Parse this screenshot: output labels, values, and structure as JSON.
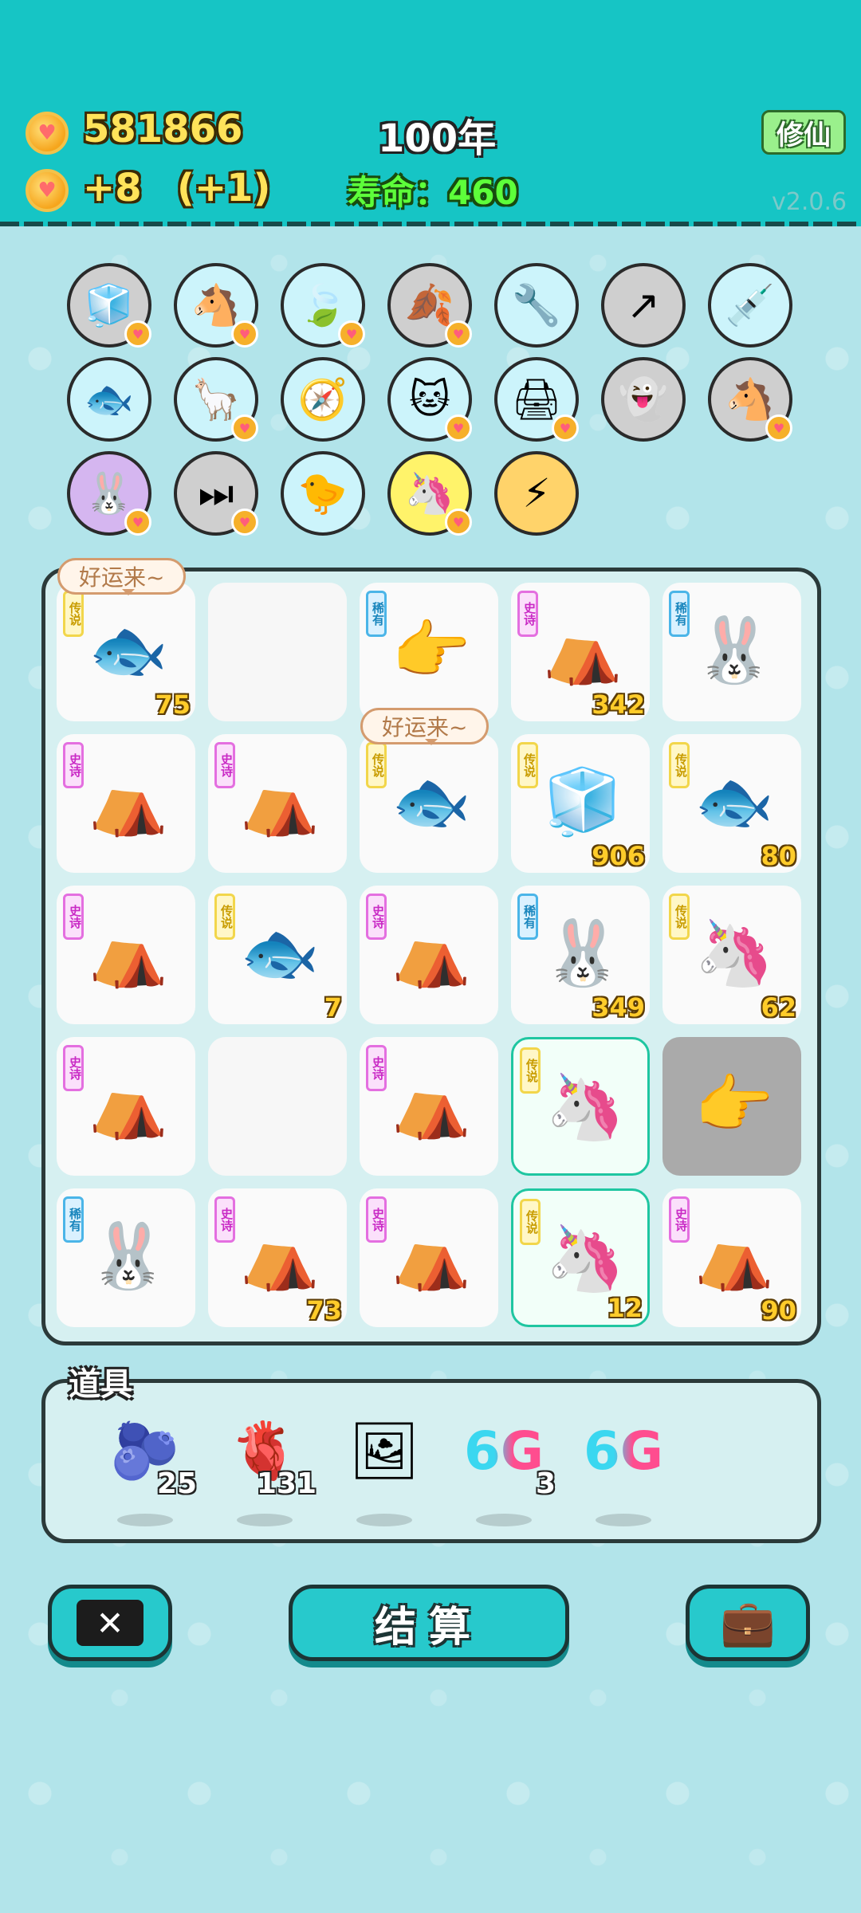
{
  "header": {
    "coins": "581866",
    "income": "+8",
    "bonus": "(+1)",
    "year": "100年",
    "lifespan": "寿命：460",
    "xiuxian_button": "修仙",
    "version": "v2.0.6"
  },
  "items": [
    {
      "icon": "🧊"
    },
    {
      "icon": "🐴"
    },
    {
      "icon": "🍃"
    },
    {
      "icon": "🍂"
    },
    {
      "icon": "🔧"
    },
    {
      "icon": "↗"
    },
    {
      "icon": "💉"
    },
    {
      "icon": "🐟"
    },
    {
      "icon": "🦙"
    },
    {
      "icon": "🧭"
    },
    {
      "icon": "🐱"
    },
    {
      "icon": "🖨"
    },
    {
      "icon": "👻"
    },
    {
      "icon": "🐴"
    },
    {
      "icon": "🐰"
    },
    {
      "icon": "⏭"
    },
    {
      "icon": "🐤"
    },
    {
      "icon": "🦄"
    },
    {
      "icon": "⚡"
    }
  ],
  "bubbles": [
    "好运来~",
    "好运来~"
  ],
  "tags": {
    "legend": "传说",
    "epic": "史诗",
    "rare": "稀有"
  },
  "board": [
    [
      {
        "tag": "legend",
        "icon": "🐟",
        "count": "75"
      },
      {
        "tag": "",
        "icon": "",
        "count": ""
      },
      {
        "tag": "rare",
        "icon": "👉",
        "count": ""
      },
      {
        "tag": "epic",
        "icon": "⛺",
        "count": "342"
      },
      {
        "tag": "rare",
        "icon": "🐰",
        "count": ""
      }
    ],
    [
      {
        "tag": "epic",
        "icon": "⛺",
        "count": ""
      },
      {
        "tag": "epic",
        "icon": "⛺",
        "count": ""
      },
      {
        "tag": "legend",
        "icon": "🐟",
        "count": ""
      },
      {
        "tag": "legend",
        "icon": "🧊",
        "count": "906"
      },
      {
        "tag": "legend",
        "icon": "🐟",
        "count": "80"
      }
    ],
    [
      {
        "tag": "epic",
        "icon": "⛺",
        "count": ""
      },
      {
        "tag": "legend",
        "icon": "🐟",
        "count": "7"
      },
      {
        "tag": "epic",
        "icon": "⛺",
        "count": ""
      },
      {
        "tag": "rare",
        "icon": "🐰",
        "count": "349"
      },
      {
        "tag": "legend",
        "icon": "🦄",
        "count": "62"
      }
    ],
    [
      {
        "tag": "epic",
        "icon": "⛺",
        "count": ""
      },
      {
        "tag": "",
        "icon": "",
        "count": ""
      },
      {
        "tag": "epic",
        "icon": "⛺",
        "count": ""
      },
      {
        "tag": "legend",
        "icon": "🦄",
        "count": ""
      },
      {
        "tag": "",
        "icon": "👉",
        "count": ""
      }
    ],
    [
      {
        "tag": "rare",
        "icon": "🐰",
        "count": ""
      },
      {
        "tag": "epic",
        "icon": "⛺",
        "count": "73"
      },
      {
        "tag": "epic",
        "icon": "⛺",
        "count": ""
      },
      {
        "tag": "legend",
        "icon": "🦄",
        "count": "12"
      },
      {
        "tag": "epic",
        "icon": "⛺",
        "count": "90"
      }
    ]
  ],
  "props_title": "道具",
  "props": [
    {
      "icon": "🫐",
      "count": "25"
    },
    {
      "icon": "🫀",
      "count": "131"
    },
    {
      "icon": "🖼",
      "count": ""
    },
    {
      "icon": "6G",
      "count": "3"
    },
    {
      "icon": "6G",
      "count": ""
    }
  ],
  "buttons": {
    "close": "✕",
    "settle": "结算",
    "bag": "💼"
  }
}
